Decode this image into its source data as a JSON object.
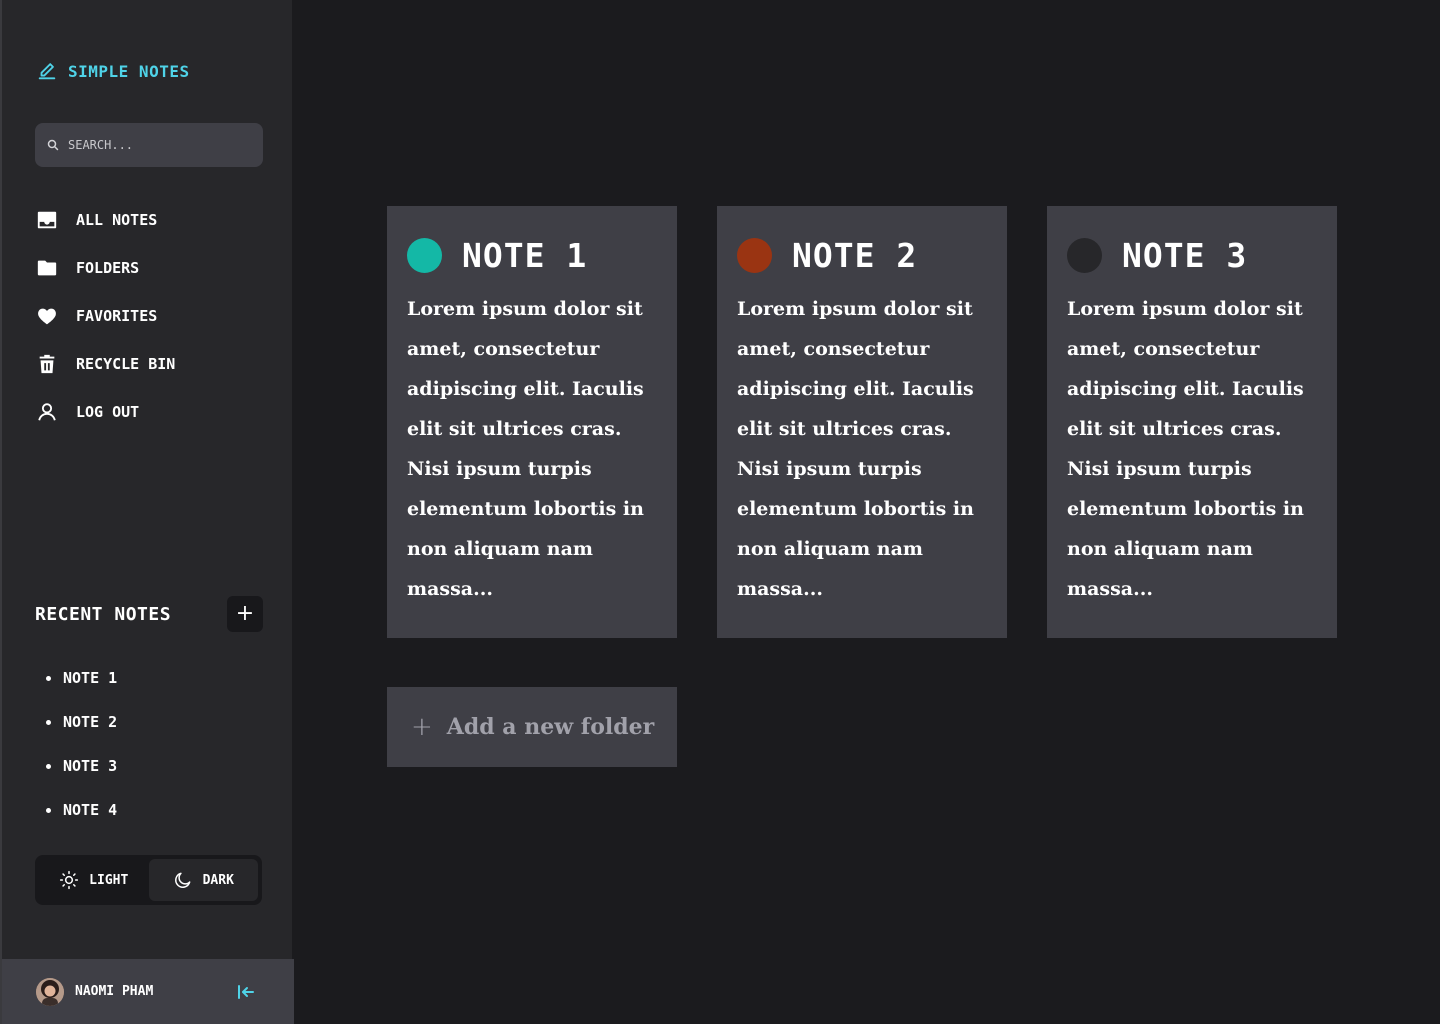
{
  "app": {
    "brand": "SIMPLE NOTES",
    "accent_color": "#4fd3e8"
  },
  "search": {
    "placeholder": "SEARCH..."
  },
  "nav": {
    "items": [
      {
        "label": "ALL NOTES",
        "icon": "inbox-icon"
      },
      {
        "label": "FOLDERS",
        "icon": "folder-icon"
      },
      {
        "label": "FAVORITES",
        "icon": "heart-icon"
      },
      {
        "label": "RECYCLE BIN",
        "icon": "trash-icon"
      },
      {
        "label": "LOG OUT",
        "icon": "user-icon"
      }
    ]
  },
  "recent": {
    "title": "RECENT NOTES",
    "add_label": "+",
    "items": [
      "NOTE 1",
      "NOTE 2",
      "NOTE 3",
      "NOTE 4"
    ]
  },
  "theme": {
    "light_label": "LIGHT",
    "dark_label": "DARK",
    "selected": "DARK"
  },
  "user": {
    "name": "NAOMI PHAM"
  },
  "notes": [
    {
      "title": "NOTE 1",
      "color": "#14b8a6",
      "body": "Lorem ipsum dolor sit amet, consectetur adipiscing elit. Iaculis elit sit ultrices cras. Nisi ipsum turpis elementum lobortis in non aliquam nam massa..."
    },
    {
      "title": "NOTE 2",
      "color": "#9a3412",
      "body": "Lorem ipsum dolor sit amet, consectetur adipiscing elit. Iaculis elit sit ultrices cras. Nisi ipsum turpis elementum lobortis in non aliquam nam massa..."
    },
    {
      "title": "NOTE 3",
      "color": "#27272a",
      "body": "Lorem ipsum dolor sit amet, consectetur adipiscing elit. Iaculis elit sit ultrices cras. Nisi ipsum turpis elementum lobortis in non aliquam nam massa..."
    }
  ],
  "new_folder": {
    "plus": "+",
    "label": "Add a new folder"
  }
}
